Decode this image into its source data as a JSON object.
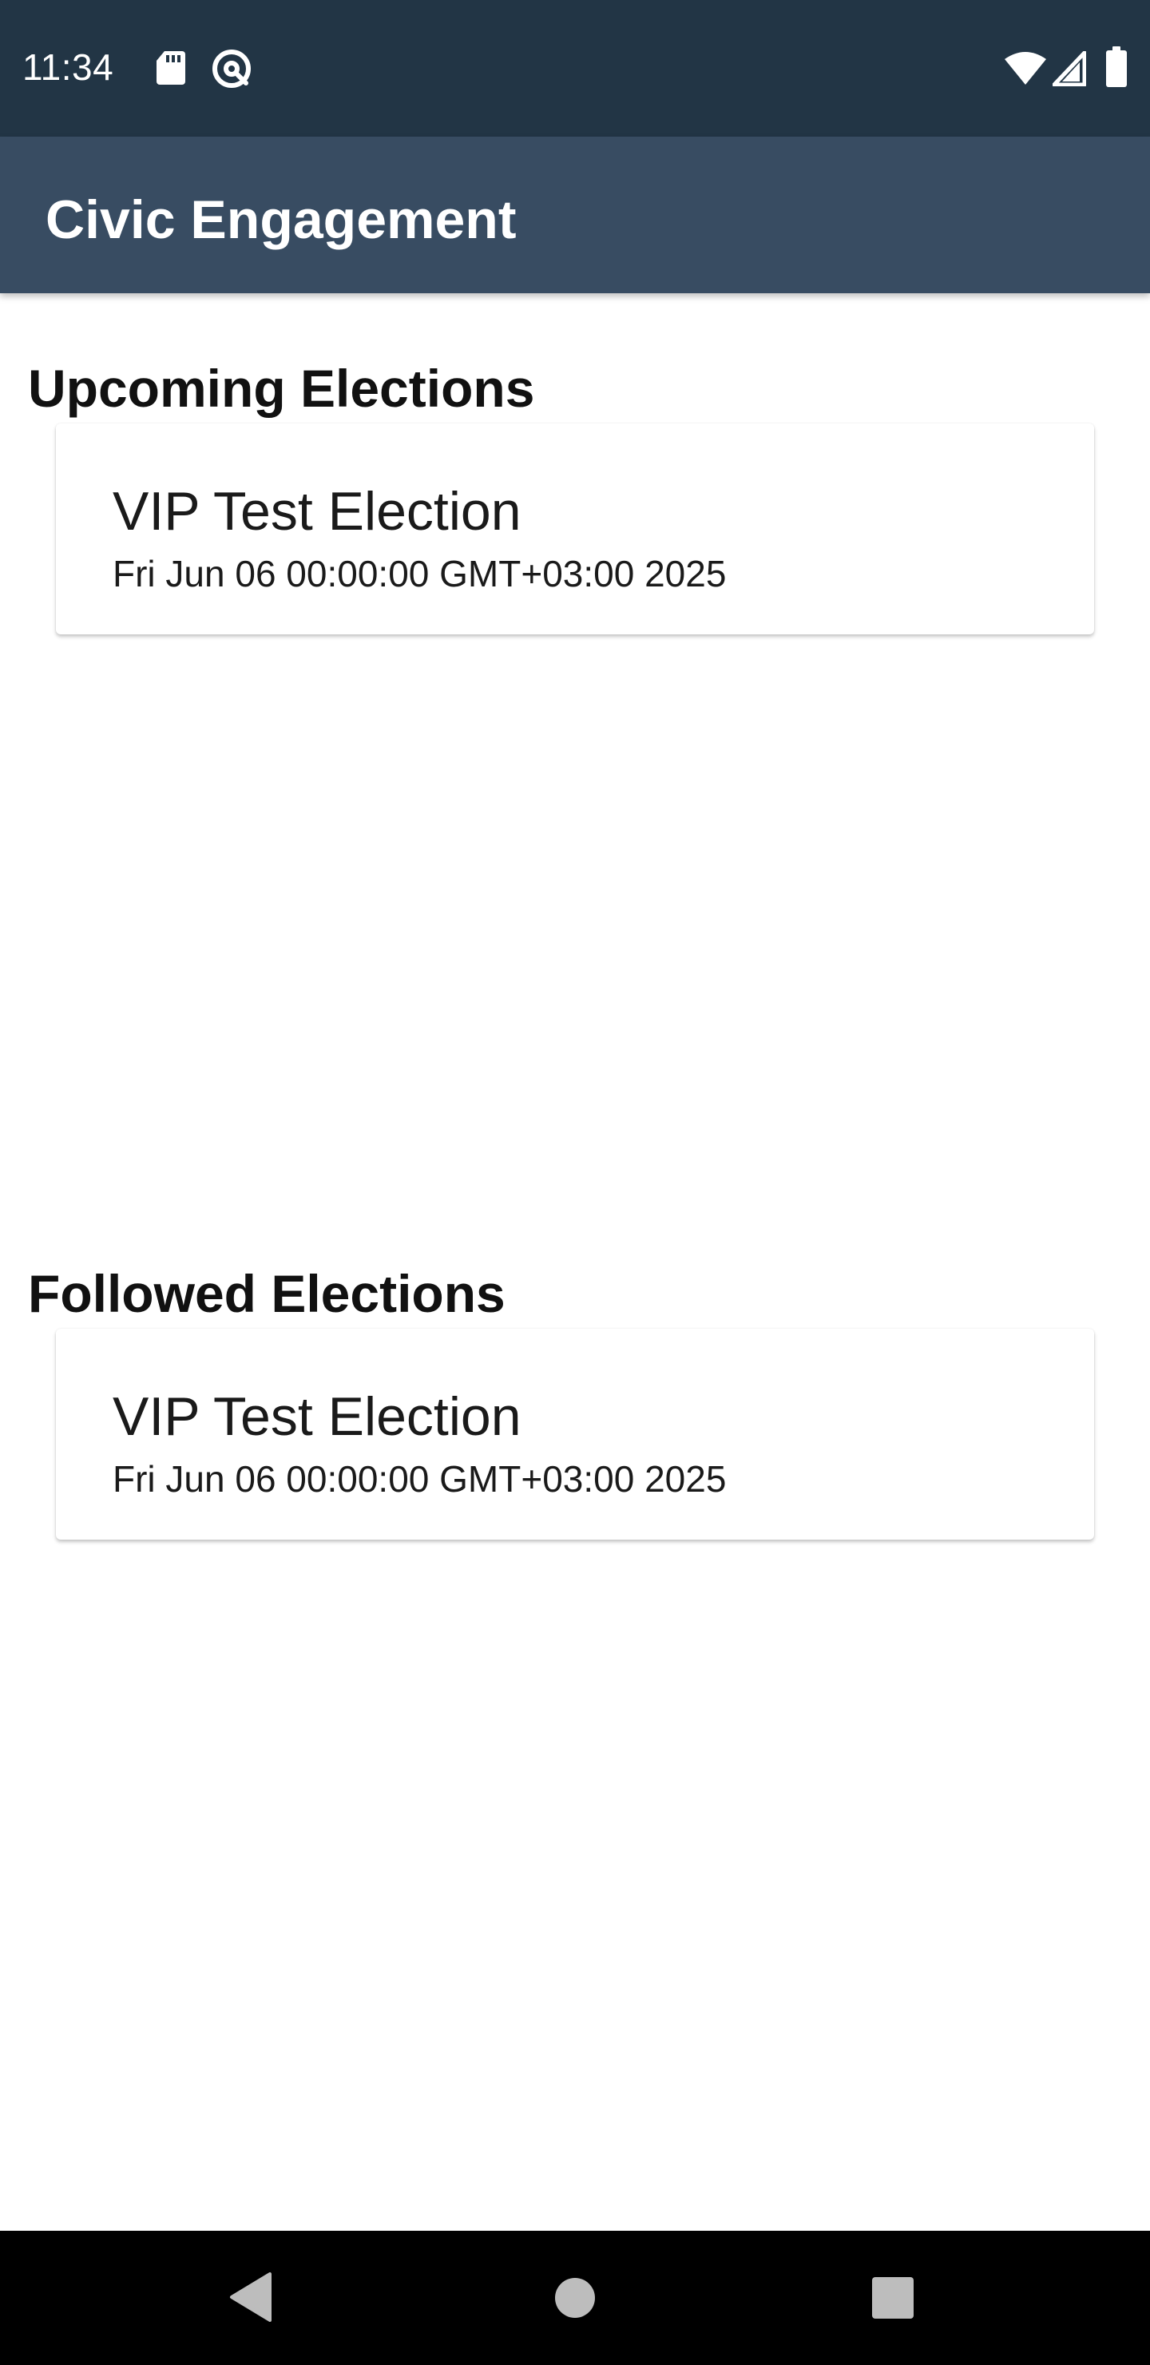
{
  "status_bar": {
    "time": "11:34",
    "icons": [
      "sd-card-icon",
      "at-sign-icon",
      "wifi-icon",
      "cell-signal-icon",
      "battery-icon"
    ]
  },
  "app_bar": {
    "title": "Civic Engagement"
  },
  "upcoming": {
    "heading": "Upcoming Elections",
    "items": [
      {
        "name": "VIP Test Election",
        "date": "Fri Jun 06 00:00:00 GMT+03:00 2025"
      }
    ]
  },
  "followed": {
    "heading": "Followed Elections",
    "items": [
      {
        "name": "VIP Test Election",
        "date": "Fri Jun 06 00:00:00 GMT+03:00 2025"
      }
    ]
  },
  "nav_bar": {
    "buttons": [
      "back-icon",
      "home-icon",
      "recents-icon"
    ]
  },
  "colors": {
    "status_bar_bg": "#223545",
    "app_bar_bg": "#384c62",
    "nav_bar_bg": "#000000",
    "text_primary": "#1a1a1a"
  }
}
